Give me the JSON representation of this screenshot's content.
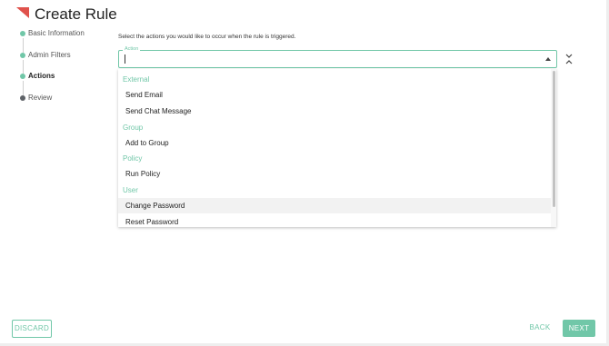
{
  "header": {
    "title": "Create Rule"
  },
  "stepper": {
    "steps": [
      {
        "label": "Basic Information",
        "state": "complete"
      },
      {
        "label": "Admin Filters",
        "state": "complete"
      },
      {
        "label": "Actions",
        "state": "active"
      },
      {
        "label": "Review",
        "state": "pending"
      }
    ]
  },
  "main": {
    "instruction": "Select the actions you would like to occur when the rule is triggered.",
    "action_field": {
      "legend": "Action",
      "value": ""
    }
  },
  "dropdown": {
    "groups": [
      {
        "label": "External",
        "items": [
          "Send Email",
          "Send Chat Message"
        ]
      },
      {
        "label": "Group",
        "items": [
          "Add to Group"
        ]
      },
      {
        "label": "Policy",
        "items": [
          "Run Policy"
        ]
      },
      {
        "label": "User",
        "items": [
          "Change Password",
          "Reset Password"
        ]
      }
    ],
    "hovered_item": "Change Password"
  },
  "footer": {
    "discard_label": "DISCARD",
    "back_label": "BACK",
    "next_label": "NEXT"
  },
  "colors": {
    "accent": "#71c7a8",
    "logo": "#e0524c",
    "pending_dot": "#5f6368"
  }
}
